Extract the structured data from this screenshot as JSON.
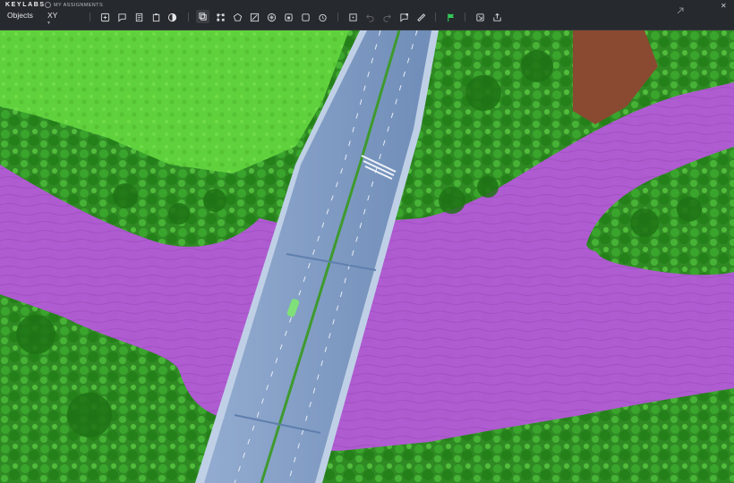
{
  "app": {
    "brand": "KEYLABS",
    "breadcrumb": "MY ASSIGNMENTS"
  },
  "panel": {
    "objects_label": "Objects",
    "axis_label": "XY"
  },
  "toolbar": {
    "icons": [
      "object-panel-icon",
      "comment-icon",
      "document-icon",
      "clipboard-icon",
      "contrast-icon",
      "bounding-box-icon",
      "keypoints-icon",
      "polygon-icon",
      "brush-icon",
      "mask-grid-icon",
      "cuboid-icon",
      "square-icon",
      "timer-icon",
      "crosshair-icon",
      "undo-icon",
      "redo-icon",
      "flag-comment-icon",
      "ruler-icon",
      "flag-icon",
      "export-icon",
      "share-icon"
    ]
  },
  "colors": {
    "topbar": "#26292d",
    "water_mask": "#b35ad6",
    "vegetation": "#3e9a2e",
    "bridge": "#7f9cc4",
    "accent_green": "#34c759"
  }
}
